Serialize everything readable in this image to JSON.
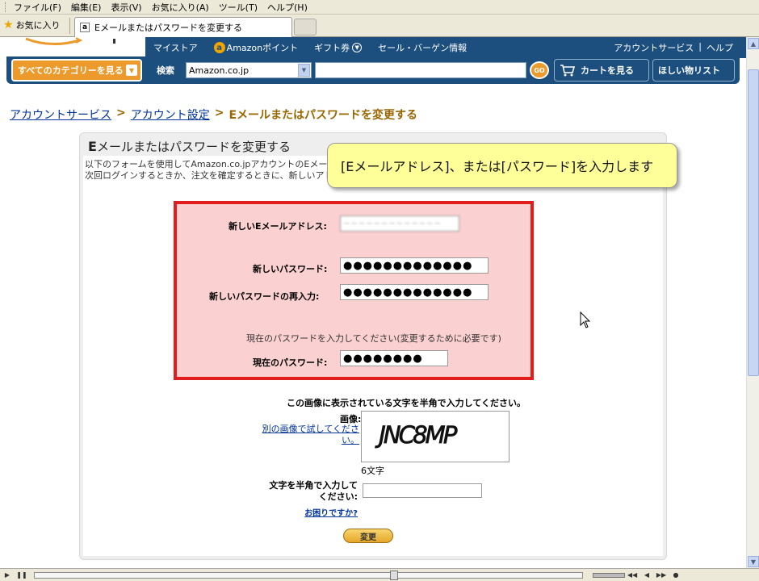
{
  "browser": {
    "menu": [
      "ファイル(F)",
      "編集(E)",
      "表示(V)",
      "お気に入り(A)",
      "ツール(T)",
      "ヘルプ(H)"
    ],
    "favorites_label": "お気に入り",
    "tab_favicon": "a",
    "tab_title": "Eメールまたはパスワードを変更する"
  },
  "header": {
    "nav_items": [
      "マイストア",
      "Amazonポイント",
      "ギフト券",
      "セール・バーゲン情報"
    ],
    "coin_icon": "a",
    "account_service": "アカウントサービス",
    "divider": "|",
    "help": "ヘルプ",
    "category_button": "すべてのカテゴリーを見る",
    "search_label": "検索",
    "search_scope": "Amazon.co.jp",
    "search_value": "",
    "go_label": "GO",
    "cart_button": "カートを見る",
    "wishlist_button": "ほしい物リスト"
  },
  "breadcrumb": {
    "items": [
      "アカウントサービス",
      "アカウント設定"
    ],
    "separator": ">",
    "current": "Eメールまたはパスワードを変更する"
  },
  "form": {
    "title_initial": "E",
    "title_rest": "メールまたはパスワードを変更する",
    "intro_line1": "以下のフォームを使用してAmazon.co.jpアカウントのEメール",
    "intro_line2": "次回ログインするときか、注文を確定するときに、新しいアドレ",
    "new_email_label": "新しいEメールアドレス:",
    "new_email_value": "~~~~~~~~~~~~~",
    "new_password_label": "新しいパスワード:",
    "new_password_value": "●●●●●●●●●●●●●",
    "confirm_password_label": "新しいパスワードの再入力:",
    "confirm_password_value": "●●●●●●●●●●●●●",
    "current_password_hint": "現在のパスワードを入力してください(変更するために必要です)",
    "current_password_label": "現在のパスワード:",
    "current_password_value": "●●●●●●●●",
    "captcha_title": "この画像に表示されている文字を半角で入力してください。",
    "captcha_image_label": "画像:",
    "captcha_alt_link": "別の画像で試してください。",
    "captcha_text": "JNC8MP",
    "captcha_count": "6文字",
    "captcha_input_label": "文字を半角で入力してください:",
    "captcha_input_value": "",
    "help_link": "お困りですか?",
    "submit_label": "変更"
  },
  "annotation": {
    "tooltip": "[Eメールアドレス]、または[パスワード]を入力します"
  },
  "colors": {
    "amazon_nav": "#1c4e7e",
    "amazon_orange": "#ec9a2b",
    "highlight_red": "#e21d1d",
    "highlight_fill": "#fbd0d0",
    "tooltip_fill": "#ffff99",
    "link_blue": "#003399",
    "crumb_brown": "#996600"
  }
}
